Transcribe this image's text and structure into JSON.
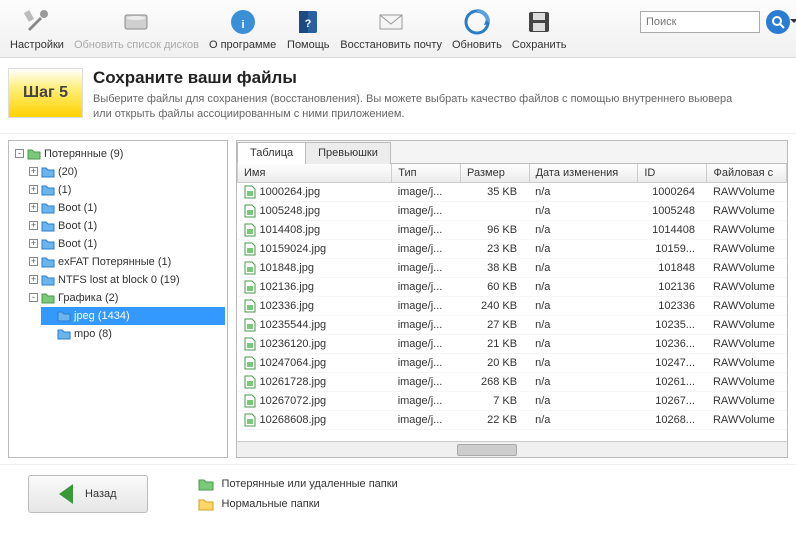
{
  "toolbar": {
    "settings": "Настройки",
    "refresh_disks": "Обновить список дисков",
    "about": "О программе",
    "help": "Помощь",
    "recover_mail": "Восстановить почту",
    "refresh": "Обновить",
    "save": "Сохранить",
    "search_placeholder": "Поиск"
  },
  "step": {
    "badge": "Шаг 5",
    "title": "Сохраните ваши файлы",
    "desc": "Выберите файлы для сохранения (восстановления). Вы можете выбрать качество файлов с помощью внутреннего вьювера или открыть файлы ассоциированным с ними приложением."
  },
  "tree": {
    "root": "Потерянные (9)",
    "children": [
      {
        "exp": "+",
        "label": "(20)"
      },
      {
        "exp": "+",
        "label": "(1)"
      },
      {
        "exp": "+",
        "label": "Boot (1)"
      },
      {
        "exp": "+",
        "label": "Boot (1)"
      },
      {
        "exp": "+",
        "label": "Boot (1)"
      },
      {
        "exp": "+",
        "label": "exFAT Потерянные (1)"
      },
      {
        "exp": "+",
        "label": "NTFS lost at block 0 (19)"
      },
      {
        "exp": "-",
        "label": "Графика (2)",
        "children": [
          {
            "label": "jpeg (1434)",
            "selected": true
          },
          {
            "label": "mpo (8)"
          }
        ]
      }
    ]
  },
  "tabs": {
    "table": "Таблица",
    "thumbs": "Превьюшки"
  },
  "columns": {
    "name": "Имя",
    "type": "Тип",
    "size": "Размер",
    "date": "Дата изменения",
    "id": "ID",
    "fs": "Файловая с"
  },
  "rows": [
    {
      "name": "1000264.jpg",
      "type": "image/j...",
      "size": "35 KB",
      "date": "n/a",
      "id": "1000264",
      "fs": "RAWVolume"
    },
    {
      "name": "1005248.jpg",
      "type": "image/j...",
      "size": "",
      "date": "n/a",
      "id": "1005248",
      "fs": "RAWVolume"
    },
    {
      "name": "1014408.jpg",
      "type": "image/j...",
      "size": "96 KB",
      "date": "n/a",
      "id": "1014408",
      "fs": "RAWVolume"
    },
    {
      "name": "10159024.jpg",
      "type": "image/j...",
      "size": "23 KB",
      "date": "n/a",
      "id": "10159...",
      "fs": "RAWVolume"
    },
    {
      "name": "101848.jpg",
      "type": "image/j...",
      "size": "38 KB",
      "date": "n/a",
      "id": "101848",
      "fs": "RAWVolume"
    },
    {
      "name": "102136.jpg",
      "type": "image/j...",
      "size": "60 KB",
      "date": "n/a",
      "id": "102136",
      "fs": "RAWVolume"
    },
    {
      "name": "102336.jpg",
      "type": "image/j...",
      "size": "240 KB",
      "date": "n/a",
      "id": "102336",
      "fs": "RAWVolume"
    },
    {
      "name": "10235544.jpg",
      "type": "image/j...",
      "size": "27 KB",
      "date": "n/a",
      "id": "10235...",
      "fs": "RAWVolume"
    },
    {
      "name": "10236120.jpg",
      "type": "image/j...",
      "size": "21 KB",
      "date": "n/a",
      "id": "10236...",
      "fs": "RAWVolume"
    },
    {
      "name": "10247064.jpg",
      "type": "image/j...",
      "size": "20 KB",
      "date": "n/a",
      "id": "10247...",
      "fs": "RAWVolume"
    },
    {
      "name": "10261728.jpg",
      "type": "image/j...",
      "size": "268 KB",
      "date": "n/a",
      "id": "10261...",
      "fs": "RAWVolume"
    },
    {
      "name": "10267072.jpg",
      "type": "image/j...",
      "size": "7 KB",
      "date": "n/a",
      "id": "10267...",
      "fs": "RAWVolume"
    },
    {
      "name": "10268608.jpg",
      "type": "image/j...",
      "size": "22 KB",
      "date": "n/a",
      "id": "10268...",
      "fs": "RAWVolume"
    }
  ],
  "footer": {
    "back": "Назад",
    "lost": "Потерянные или удаленные папки",
    "normal": "Нормальные папки"
  }
}
